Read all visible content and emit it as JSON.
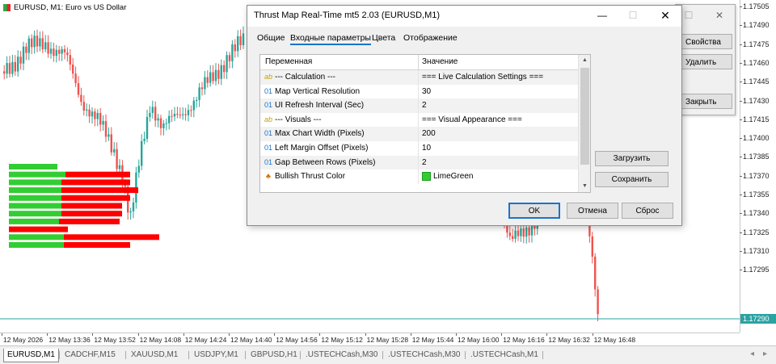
{
  "chart": {
    "symbol_title": "EURUSD, M1:  Euro vs US Dollar",
    "price_labels": [
      "1.17505",
      "1.17490",
      "1.17475",
      "1.17460",
      "1.17445",
      "1.17430",
      "1.17415",
      "1.17400",
      "1.17385",
      "1.17370",
      "1.17355",
      "1.17340",
      "1.17325",
      "1.17310",
      "1.17295"
    ],
    "current_price": "1.17290",
    "time_labels": [
      "12 May 2026",
      "12 May 13:36",
      "12 May 13:52",
      "12 May 14:08",
      "12 May 14:24",
      "12 May 14:40",
      "12 May 14:56",
      "12 May 15:12",
      "12 May 15:28",
      "12 May 15:44",
      "12 May 16:00",
      "12 May 16:16",
      "12 May 16:32",
      "12 May 16:48"
    ],
    "colors": {
      "bull": "#26a69a",
      "bear": "#ef5350",
      "map_bull": "#32cd32",
      "map_bear": "#ff0000",
      "current_line": "#2aa3a3"
    }
  },
  "symbol_tabs": [
    "EURUSD,M1",
    "CADCHF,M15",
    "XAUUSD,M1",
    "USDJPY,M1",
    "GBPUSD,H1",
    ".USTECHCash,M30",
    ".USTECHCash,M30",
    ".USTECHCash,M1"
  ],
  "background_window": {
    "buttons": [
      "Свойства",
      "Удалить",
      "Закрыть"
    ]
  },
  "dialog": {
    "title": "Thrust Map Real-Time mt5 2.03 (EURUSD,M1)",
    "tabs": [
      "Общие",
      "Входные параметры",
      "Цвета",
      "Отображение"
    ],
    "active_tab": "Входные параметры",
    "columns": {
      "name": "Переменная",
      "value": "Значение"
    },
    "rows": [
      {
        "icon": "ab",
        "name": "--- Calculation ---",
        "value": "=== Live Calculation Settings ==="
      },
      {
        "icon": "01",
        "name": "Map Vertical Resolution",
        "value": "30"
      },
      {
        "icon": "01",
        "name": "UI Refresh Interval (Sec)",
        "value": "2"
      },
      {
        "icon": "ab",
        "name": "--- Visuals ---",
        "value": "=== Visual Appearance ==="
      },
      {
        "icon": "01",
        "name": "Max Chart Width (Pixels)",
        "value": "200"
      },
      {
        "icon": "01",
        "name": "Left Margin Offset (Pixels)",
        "value": "10"
      },
      {
        "icon": "01",
        "name": "Gap Between Rows (Pixels)",
        "value": "2"
      },
      {
        "icon": "palette",
        "name": "Bullish Thrust Color",
        "value": "LimeGreen",
        "swatch": "#32cd32"
      }
    ],
    "load_button": "Загрузить",
    "save_button": "Сохранить",
    "ok_button": "OK",
    "cancel_button": "Отмена",
    "reset_button": "Сброс"
  }
}
